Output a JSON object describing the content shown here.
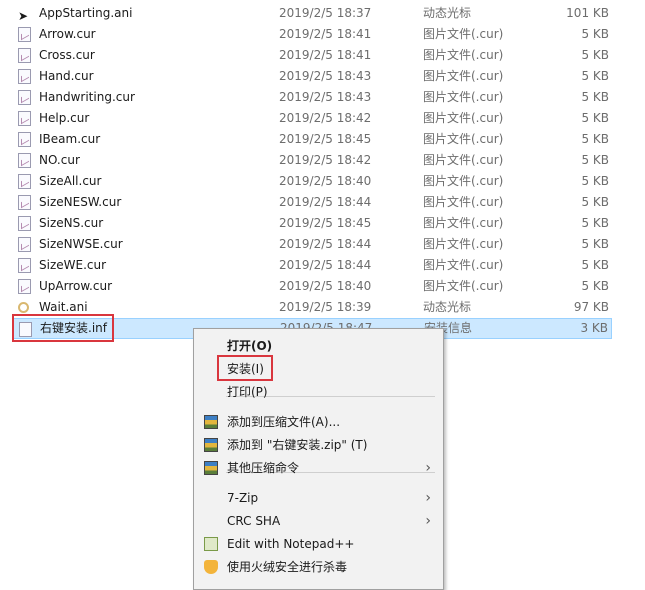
{
  "files": [
    {
      "name": "AppStarting.ani",
      "date": "2019/2/5 18:37",
      "type": "动态光标",
      "size": "101 KB",
      "icon": "animated-cursor-icon"
    },
    {
      "name": "Arrow.cur",
      "date": "2019/2/5 18:41",
      "type": "图片文件(.cur)",
      "size": "5 KB",
      "icon": "cursor-file-icon"
    },
    {
      "name": "Cross.cur",
      "date": "2019/2/5 18:41",
      "type": "图片文件(.cur)",
      "size": "5 KB",
      "icon": "cursor-file-icon"
    },
    {
      "name": "Hand.cur",
      "date": "2019/2/5 18:43",
      "type": "图片文件(.cur)",
      "size": "5 KB",
      "icon": "cursor-file-icon"
    },
    {
      "name": "Handwriting.cur",
      "date": "2019/2/5 18:43",
      "type": "图片文件(.cur)",
      "size": "5 KB",
      "icon": "cursor-file-icon"
    },
    {
      "name": "Help.cur",
      "date": "2019/2/5 18:42",
      "type": "图片文件(.cur)",
      "size": "5 KB",
      "icon": "cursor-file-icon"
    },
    {
      "name": "IBeam.cur",
      "date": "2019/2/5 18:45",
      "type": "图片文件(.cur)",
      "size": "5 KB",
      "icon": "cursor-file-icon"
    },
    {
      "name": "NO.cur",
      "date": "2019/2/5 18:42",
      "type": "图片文件(.cur)",
      "size": "5 KB",
      "icon": "cursor-file-icon"
    },
    {
      "name": "SizeAll.cur",
      "date": "2019/2/5 18:40",
      "type": "图片文件(.cur)",
      "size": "5 KB",
      "icon": "cursor-file-icon"
    },
    {
      "name": "SizeNESW.cur",
      "date": "2019/2/5 18:44",
      "type": "图片文件(.cur)",
      "size": "5 KB",
      "icon": "cursor-file-icon"
    },
    {
      "name": "SizeNS.cur",
      "date": "2019/2/5 18:45",
      "type": "图片文件(.cur)",
      "size": "5 KB",
      "icon": "cursor-file-icon"
    },
    {
      "name": "SizeNWSE.cur",
      "date": "2019/2/5 18:44",
      "type": "图片文件(.cur)",
      "size": "5 KB",
      "icon": "cursor-file-icon"
    },
    {
      "name": "SizeWE.cur",
      "date": "2019/2/5 18:44",
      "type": "图片文件(.cur)",
      "size": "5 KB",
      "icon": "cursor-file-icon"
    },
    {
      "name": "UpArrow.cur",
      "date": "2019/2/5 18:40",
      "type": "图片文件(.cur)",
      "size": "5 KB",
      "icon": "cursor-file-icon"
    },
    {
      "name": "Wait.ani",
      "date": "2019/2/5 18:39",
      "type": "动态光标",
      "size": "97 KB",
      "icon": "wait-cursor-icon"
    },
    {
      "name": "右键安装.inf",
      "date": "2019/2/5 18:47",
      "type": "安装信息",
      "size": "3 KB",
      "icon": "inf-file-icon",
      "selected": true
    }
  ],
  "context_menu": {
    "items": [
      {
        "label": "打开(O)",
        "bold": true
      },
      {
        "label": "安装(I)",
        "highlighted": true
      },
      {
        "label": "打印(P)"
      },
      {
        "label": "添加到压缩文件(A)...",
        "icon": "winrar-icon"
      },
      {
        "label": "添加到 \"右键安装.zip\" (T)",
        "icon": "winrar-icon"
      },
      {
        "label": "其他压缩命令",
        "icon": "winrar-icon",
        "submenu": true
      },
      {
        "label": "7-Zip",
        "submenu": true
      },
      {
        "label": "CRC SHA",
        "submenu": true
      },
      {
        "label": "Edit with Notepad++",
        "icon": "notepad-plus-plus-icon"
      },
      {
        "label": "使用火绒安全进行杀毒",
        "icon": "huorong-shield-icon"
      }
    ]
  },
  "colors": {
    "selection": "#cce8ff",
    "highlight_box": "#d9363e"
  }
}
